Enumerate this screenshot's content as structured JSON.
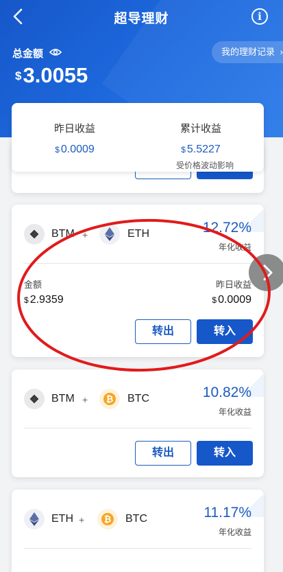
{
  "header": {
    "title": "超导理财",
    "total_label": "总金额",
    "currency": "$",
    "total_value": "3.0055",
    "records_label": "我的理财记录"
  },
  "summary": {
    "yesterday_label": "昨日收益",
    "yesterday_value": "0.0009",
    "cumulative_label": "累计收益",
    "cumulative_value": "5.5227",
    "note": "受价格波动影响"
  },
  "products": [
    {
      "coin_a": "BTM",
      "coin_b": "ETH",
      "plus": "+",
      "rate": "12.72%",
      "rate_label": "年化收益",
      "amount_label": "金额",
      "amount_value": "2.9359",
      "yesterday_label": "昨日收益",
      "yesterday_value": "0.0009",
      "out_label": "转出",
      "in_label": "转入"
    },
    {
      "coin_a": "BTM",
      "coin_b": "BTC",
      "plus": "+",
      "rate": "10.82%",
      "rate_label": "年化收益",
      "out_label": "转出",
      "in_label": "转入"
    },
    {
      "coin_a": "ETH",
      "coin_b": "BTC",
      "plus": "+",
      "rate": "11.17%",
      "rate_label": "年化收益"
    }
  ],
  "colors": {
    "primary": "#1657c9",
    "accent_text": "#1b5bbf",
    "annotation": "#e01b1b"
  }
}
